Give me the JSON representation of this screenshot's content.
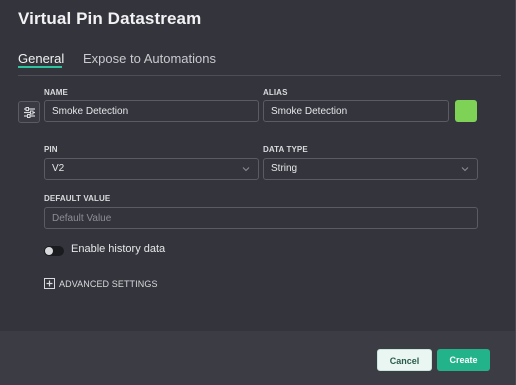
{
  "dialog": {
    "title": "Virtual Pin Datastream"
  },
  "tabs": [
    {
      "label": "General",
      "active": true
    },
    {
      "label": "Expose to Automations",
      "active": false
    }
  ],
  "icon_button": {
    "icon": "list-settings-icon"
  },
  "fields": {
    "name": {
      "label": "NAME",
      "value": "Smoke Detection"
    },
    "alias": {
      "label": "ALIAS",
      "value": "Smoke Detection"
    },
    "color": {
      "value": "#7ed357"
    },
    "pin": {
      "label": "PIN",
      "value": "V2"
    },
    "data_type": {
      "label": "DATA TYPE",
      "value": "String"
    },
    "default_value": {
      "label": "DEFAULT VALUE",
      "value": "",
      "placeholder": "Default Value"
    }
  },
  "history_toggle": {
    "label": "Enable history data",
    "enabled": false
  },
  "advanced": {
    "label": "ADVANCED SETTINGS",
    "icon": "plus-box-icon"
  },
  "footer": {
    "cancel_label": "Cancel",
    "create_label": "Create"
  },
  "colors": {
    "accent": "#23b38a",
    "background": "#34353c",
    "footer_background": "#3c3d44"
  }
}
